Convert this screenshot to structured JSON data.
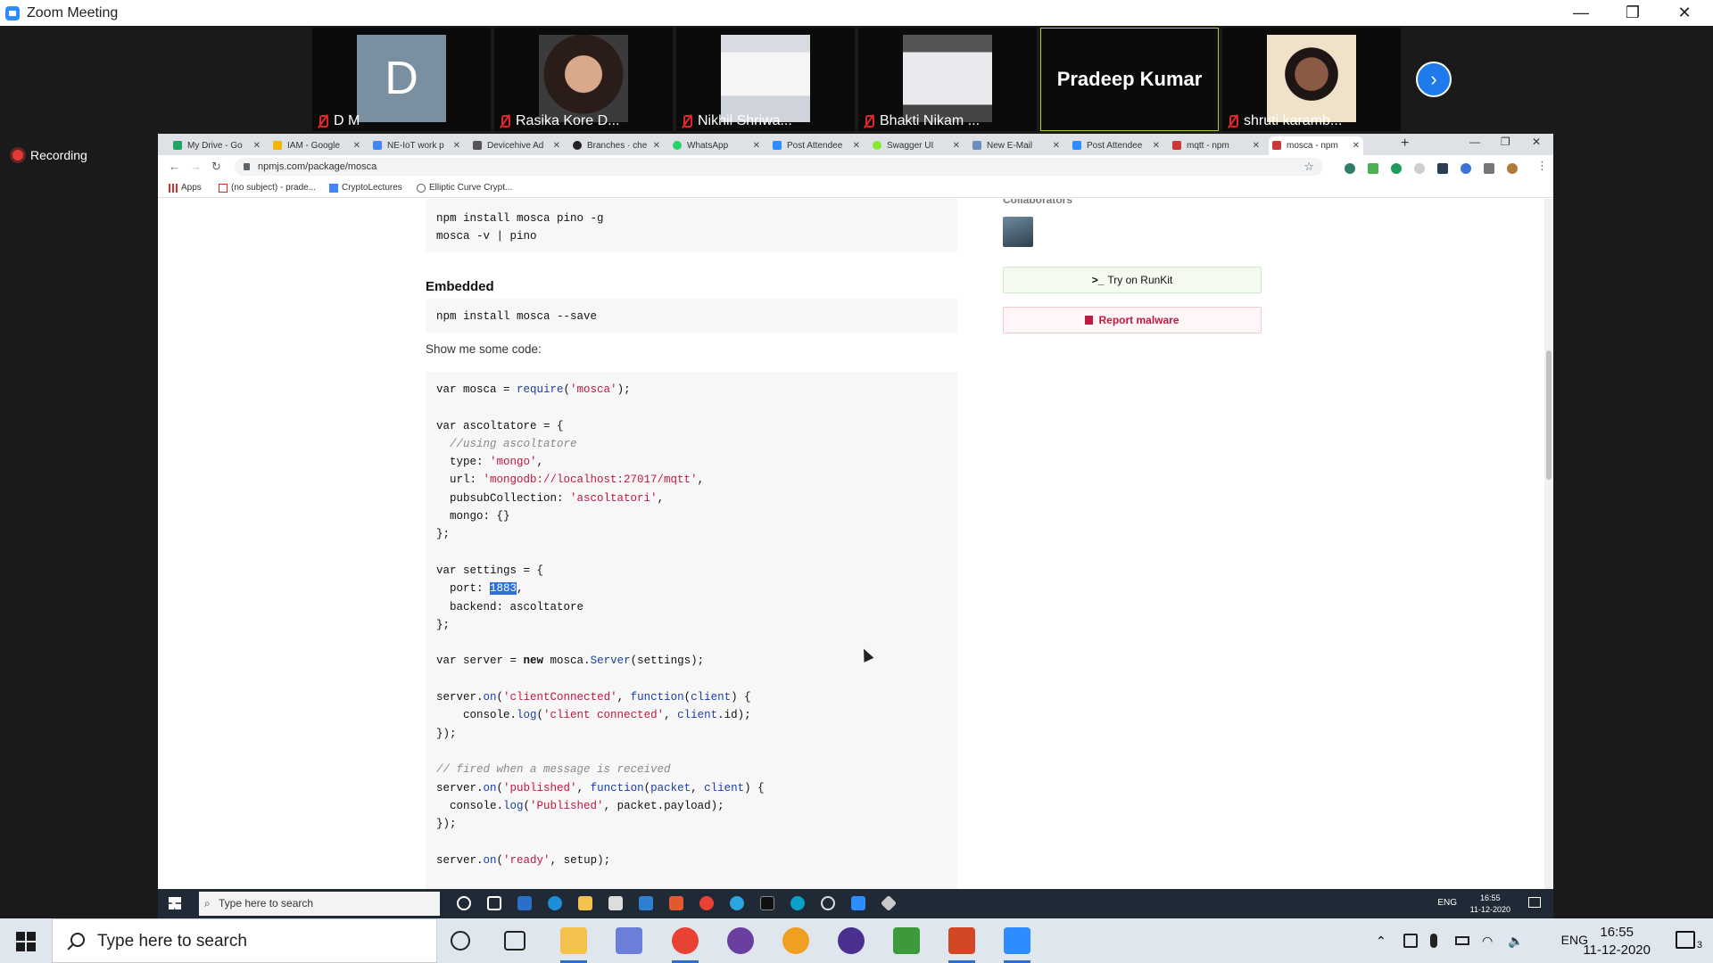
{
  "zoom": {
    "window_title": "Zoom Meeting",
    "recording_label": "Recording",
    "participants": [
      {
        "name": "D M",
        "avatar_letter": "D"
      },
      {
        "name": "Rasika Kore D..."
      },
      {
        "name": "Nikhil Shriwa..."
      },
      {
        "name": "Bhakti Nikam ..."
      },
      {
        "name": "Pradeep Kumar"
      },
      {
        "name": "shruti karamb..."
      }
    ]
  },
  "browser": {
    "tabs": [
      {
        "label": "My Drive - Go",
        "color": "#1fa463"
      },
      {
        "label": "IAM - Google",
        "color": "#f4b400"
      },
      {
        "label": "NE-IoT work p",
        "color": "#4285f4"
      },
      {
        "label": "Devicehive Ad",
        "color": "#555555"
      },
      {
        "label": "Branches · che",
        "color": "#222222"
      },
      {
        "label": "WhatsApp",
        "color": "#25d366"
      },
      {
        "label": "Post Attendee",
        "color": "#2d8cff"
      },
      {
        "label": "Swagger UI",
        "color": "#85ea2d"
      },
      {
        "label": "New E-Mail",
        "color": "#6b8ebf"
      },
      {
        "label": "Post Attendee",
        "color": "#2d8cff"
      },
      {
        "label": "mqtt - npm",
        "color": "#cb3837"
      },
      {
        "label": "mosca - npm",
        "color": "#cb3837"
      }
    ],
    "url": "npmjs.com/package/mosca",
    "bookmarks": [
      {
        "label": "Apps"
      },
      {
        "label": "(no subject) - prade..."
      },
      {
        "label": "CryptoLectures"
      },
      {
        "label": "Elliptic Curve Crypt..."
      }
    ]
  },
  "page": {
    "install_lines": [
      "npm install mosca pino -g",
      "mosca -v | pino"
    ],
    "embedded_heading": "Embedded",
    "embedded_cmd": "npm install mosca --save",
    "show_code_text": "Show me some code:",
    "collaborators_label": "Collaborators",
    "runkit_prefix": ">_",
    "runkit_label": "Try on RunKit",
    "malware_label": "Report malware",
    "highlighted_port": "1883"
  },
  "inner_taskbar": {
    "search_placeholder": "Type here to search",
    "lang": "ENG",
    "time": "16:55",
    "date": "11-12-2020"
  },
  "taskbar": {
    "search_placeholder": "Type here to search",
    "lang": "ENG",
    "time": "16:55",
    "date": "11-12-2020",
    "notifications": "3"
  }
}
